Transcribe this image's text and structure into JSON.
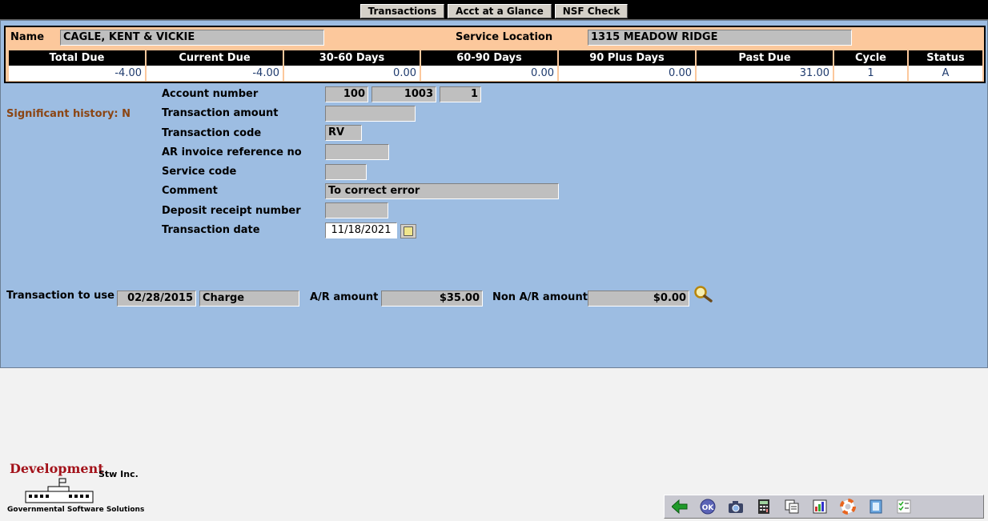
{
  "tabs": [
    "Transactions",
    "Acct at a Glance",
    "NSF Check"
  ],
  "header": {
    "name_label": "Name",
    "name_value": "CAGLE, KENT & VICKIE",
    "service_location_label": "Service Location",
    "service_location_value": "1315 MEADOW RIDGE"
  },
  "summary": {
    "headers": [
      "Total Due",
      "Current Due",
      "30-60 Days",
      "60-90 Days",
      "90 Plus Days",
      "Past Due",
      "Cycle",
      "Status"
    ],
    "values": [
      "-4.00",
      "-4.00",
      "0.00",
      "0.00",
      "0.00",
      "31.00",
      "1",
      "A"
    ]
  },
  "significant_history": "Significant history: N",
  "form": {
    "account_number_label": "Account number",
    "account_number_parts": [
      "100",
      "1003",
      "1"
    ],
    "transaction_amount_label": "Transaction amount",
    "transaction_amount_value": "",
    "transaction_code_label": "Transaction code",
    "transaction_code_value": "RV",
    "ar_invoice_label": "AR invoice reference no",
    "ar_invoice_value": "",
    "service_code_label": "Service code",
    "service_code_value": "",
    "comment_label": "Comment",
    "comment_value": "To correct error",
    "deposit_receipt_label": "Deposit receipt number",
    "deposit_receipt_value": "",
    "transaction_date_label": "Transaction date",
    "transaction_date_value": "11/18/2021"
  },
  "transaction_to_use": {
    "label": "Transaction to use",
    "date": "02/28/2015",
    "type": "Charge",
    "ar_amount_label": "A/R amount",
    "ar_amount_value": "$35.00",
    "non_ar_amount_label": "Non A/R amount",
    "non_ar_amount_value": "$0.00"
  },
  "footer": {
    "logo_text": "Development",
    "logo_sub": "Stw Inc.",
    "logo_tagline": "Governmental Software Solutions",
    "toolbar_icons": [
      "back-arrow-icon",
      "ok-icon",
      "camera-icon",
      "calculator-icon",
      "copy-icon",
      "report-icon",
      "help-lifebuoy-icon",
      "notes-icon",
      "checklist-icon"
    ]
  },
  "colors": {
    "panel_blue": "#9dbde2",
    "header_peach": "#fcc89c",
    "history_brown": "#8b4513",
    "logo_red": "#a3121a"
  }
}
